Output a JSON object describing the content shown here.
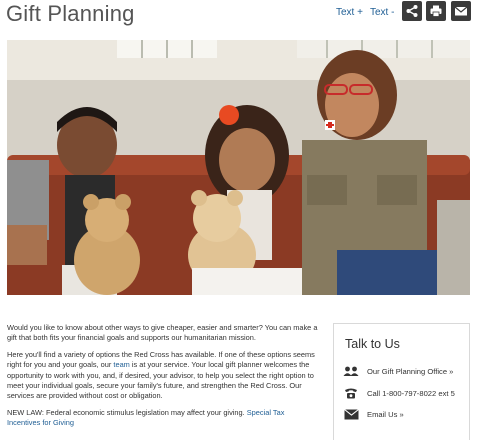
{
  "header": {
    "title": "Gift Planning",
    "text_increase": "Text +",
    "text_decrease": "Text -"
  },
  "toolbar": {
    "share_icon": "share-icon",
    "print_icon": "print-icon",
    "email_icon": "email-icon"
  },
  "hero": {
    "icon": "photo-of-red-cross-volunteer-with-children-and-teddy-bears"
  },
  "intro": {
    "p1": "Would you like to know about other ways to give cheaper, easier and smarter? You can make a gift that both fits your financial goals and supports our humanitarian mission.",
    "p2_before": "Here you'll find a variety of options the Red Cross has available. If one of these options seems right for you and your goals, our ",
    "p2_link": "team",
    "p2_after": " is at your service. Your local gift planner welcomes the opportunity to work with you, and, if desired, your advisor, to help you select the right option to meet your individual goals, secure your family's future, and strengthen the Red Cross. Our services are provided without cost or obligation.",
    "p3_before": "NEW LAW: Federal economic stimulus legislation may affect your giving. ",
    "p3_link": "Special Tax Incentives for Giving"
  },
  "talk": {
    "title": "Talk to Us",
    "office": "Our Gift Planning Office »",
    "call": "Call 1-800-797-8022 ext 5",
    "email": "Email Us »"
  },
  "colors": {
    "link": "#1f5e94",
    "toolbar_button": "#3b3b3b",
    "red_cross": "#d52b1e"
  }
}
